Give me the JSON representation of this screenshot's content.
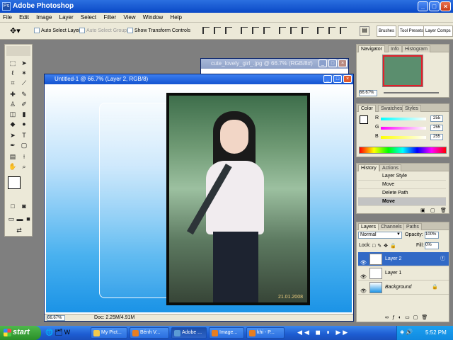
{
  "app": {
    "title": "Adobe Photoshop"
  },
  "menu": [
    "File",
    "Edit",
    "Image",
    "Layer",
    "Select",
    "Filter",
    "View",
    "Window",
    "Help"
  ],
  "options": {
    "auto_select_layer": "Auto Select Layer",
    "auto_select_groups": "Auto Select Groups",
    "show_transform_controls": "Show Transform Controls",
    "well_tabs": [
      "Brushes",
      "Tool Presets",
      "Layer Comps"
    ]
  },
  "documents": {
    "back": {
      "title": "cute_lovely_girl_.jpg @ 66.7% (RGB/8#)"
    },
    "front": {
      "title": "Untitled-1 @ 66.7% (Layer 2, RGB/8)",
      "zoom": "66.67%",
      "doc_info": "Doc: 2.25M/4.91M",
      "photo_watermark": "21.01.2008"
    }
  },
  "navigator": {
    "tabs": [
      "Navigator",
      "Info",
      "Histogram"
    ],
    "zoom": "66.67%"
  },
  "color": {
    "tabs": [
      "Color",
      "Swatches",
      "Styles"
    ],
    "r_label": "R",
    "g_label": "G",
    "b_label": "B",
    "r": "255",
    "g": "255",
    "b": "255"
  },
  "history": {
    "tabs": [
      "History",
      "Actions"
    ],
    "items": [
      "Layer Style",
      "Move",
      "Delete Path",
      "Move"
    ]
  },
  "layers": {
    "tabs": [
      "Layers",
      "Channels",
      "Paths"
    ],
    "blend_mode": "Normal",
    "opacity_label": "Opacity:",
    "opacity": "100%",
    "lock_label": "Lock:",
    "fill_label": "Fill:",
    "fill": "0%",
    "items": [
      "Layer 2",
      "Layer 1",
      "Background"
    ]
  },
  "taskbar": {
    "start": "start",
    "items": [
      "My Pict...",
      "Bénh V...",
      "Adobe ...",
      "Image...",
      "khi - P..."
    ],
    "clock": "5:52 PM"
  },
  "colors": {
    "accent": "#0a49c6",
    "selection": "#3169c6",
    "canvas_blue": "#1b93e6",
    "taskbar": "#1d5cd1",
    "start_green": "#2a8f28"
  }
}
